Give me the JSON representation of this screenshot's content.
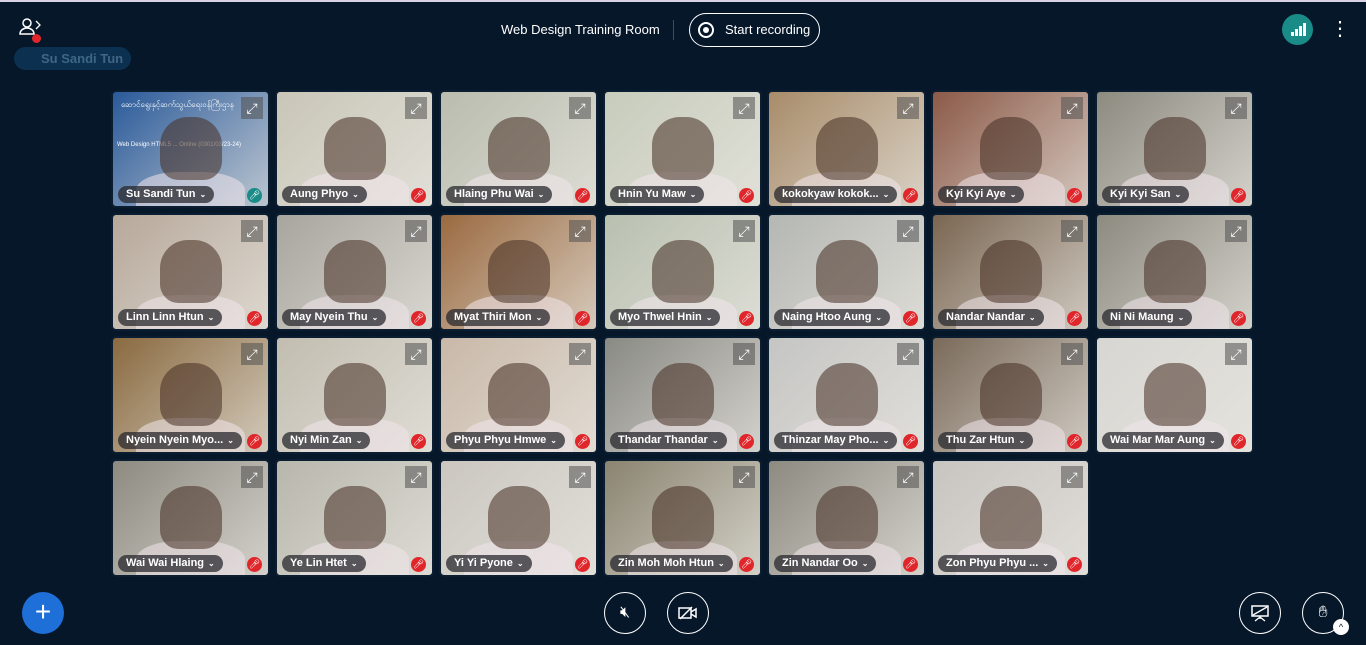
{
  "header": {
    "title": "Web Design Training Room",
    "record_label": "Start recording",
    "talking_indicator": "Su Sandi Tun"
  },
  "colors": {
    "background": "#06172a",
    "accent": "#1a8c87",
    "muted": "#e1262b",
    "primary": "#1f6fd9"
  },
  "presenter_slide": {
    "line1": "ဆောင်ရွေးနှင့်ဆက်သွယ်ရေးဝန်ကြီးဌာန",
    "line2": "Web Design HTML5 ... Online (0301/03/23-24)"
  },
  "participants": [
    {
      "name": "Su Sandi Tun",
      "mic": "on",
      "tone": "#2a5a9a"
    },
    {
      "name": "Aung Phyo",
      "mic": "muted",
      "tone": "#c9c6b8"
    },
    {
      "name": "Hlaing Phu Wai",
      "mic": "muted",
      "tone": "#b9bcae"
    },
    {
      "name": "Hnin Yu Maw",
      "mic": "muted",
      "tone": "#c7ccbc"
    },
    {
      "name": "kokokyaw kokok...",
      "mic": "muted",
      "tone": "#a88c6a"
    },
    {
      "name": "Kyi Kyi Aye",
      "mic": "muted",
      "tone": "#8c5a48"
    },
    {
      "name": "Kyi Kyi San",
      "mic": "muted",
      "tone": "#8d8a80"
    },
    {
      "name": "Linn Linn Htun",
      "mic": "muted",
      "tone": "#b7a89a"
    },
    {
      "name": "May Nyein Thu",
      "mic": "muted",
      "tone": "#a8a49e"
    },
    {
      "name": "Myat Thiri Mon",
      "mic": "muted",
      "tone": "#9a6a40"
    },
    {
      "name": "Myo Thwel Hnin",
      "mic": "muted",
      "tone": "#b8c0b0"
    },
    {
      "name": "Naing Htoo Aung",
      "mic": "muted",
      "tone": "#b5b7b3"
    },
    {
      "name": "Nandar Nandar",
      "mic": "muted",
      "tone": "#7a6652"
    },
    {
      "name": "Ni Ni Maung",
      "mic": "muted",
      "tone": "#8d8a80"
    },
    {
      "name": "Nyein Nyein Myo...",
      "mic": "muted",
      "tone": "#8a6a40"
    },
    {
      "name": "Nyi Min Zan",
      "mic": "muted",
      "tone": "#c2bdb0"
    },
    {
      "name": "Phyu Phyu Hmwe",
      "mic": "muted",
      "tone": "#c9b8a8"
    },
    {
      "name": "Thandar Thandar",
      "mic": "muted",
      "tone": "#8a8a84"
    },
    {
      "name": "Thinzar May Pho...",
      "mic": "muted",
      "tone": "#c5c5c3"
    },
    {
      "name": "Thu Zar Htun",
      "mic": "muted",
      "tone": "#7a6a5a"
    },
    {
      "name": "Wai Mar Mar Aung",
      "mic": "muted",
      "tone": "#d8d6d2"
    },
    {
      "name": "Wai Wai Hlaing",
      "mic": "muted",
      "tone": "#8d8a80"
    },
    {
      "name": "Ye Lin Htet",
      "mic": "muted",
      "tone": "#b8b7ac"
    },
    {
      "name": "Yi Yi Pyone",
      "mic": "muted",
      "tone": "#cbc6c0"
    },
    {
      "name": "Zin Moh Moh Htun",
      "mic": "muted",
      "tone": "#8a8470"
    },
    {
      "name": "Zin Nandar Oo",
      "mic": "muted",
      "tone": "#8d8a80"
    },
    {
      "name": "Zon Phyu Phyu ...",
      "mic": "muted",
      "tone": "#c8c4c0"
    }
  ],
  "controls": {
    "audio": "speaker-muted-icon",
    "video": "camera-off-icon",
    "share": "screen-share-icon",
    "raise_hand": "hand-icon",
    "actions": "plus-icon"
  }
}
